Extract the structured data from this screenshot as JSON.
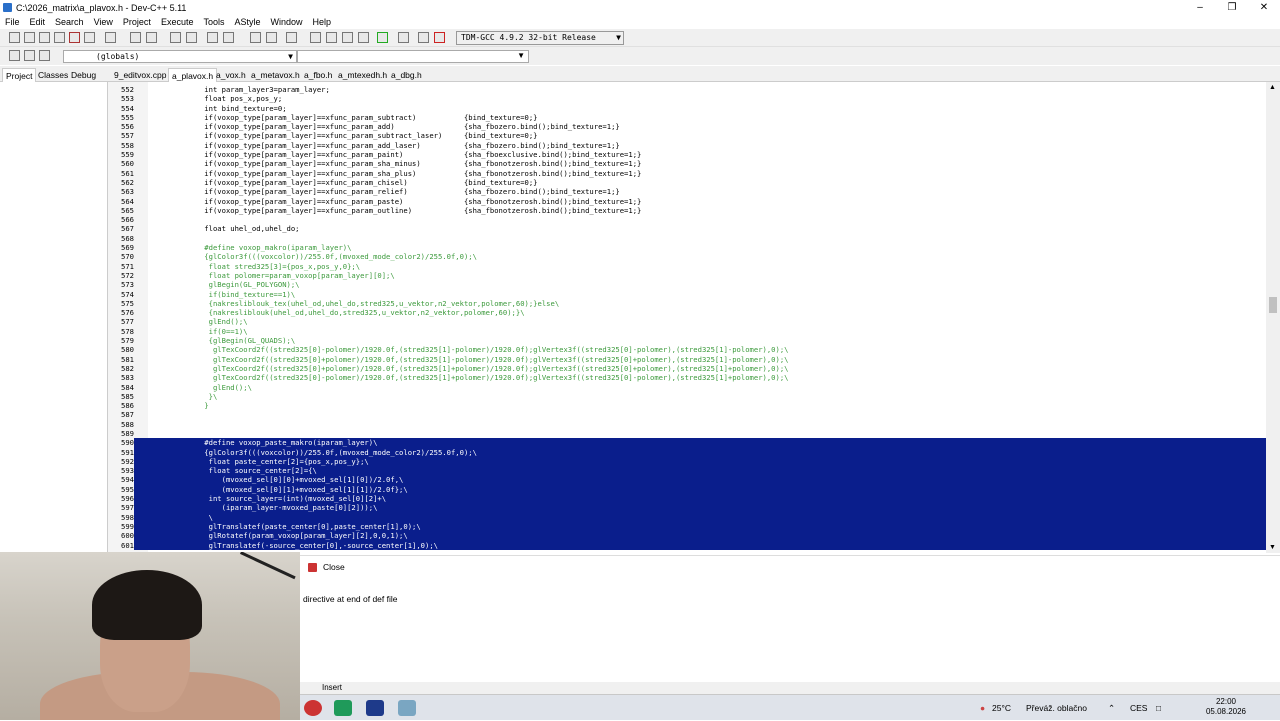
{
  "window": {
    "title": "C:\\2026_matrix\\a_plavox.h - Dev-C++ 5.11"
  },
  "menu": [
    "File",
    "Edit",
    "Search",
    "View",
    "Project",
    "Execute",
    "Tools",
    "AStyle",
    "Window",
    "Help"
  ],
  "compiler": "TDM-GCC 4.9.2 32-bit Release",
  "scope": "(globals)",
  "panel_tabs": [
    "Project",
    "Classes",
    "Debug"
  ],
  "file_tabs": [
    {
      "label": "9_editvox.cpp",
      "active": false
    },
    {
      "label": "a_plavox.h",
      "active": true
    },
    {
      "label": "a_vox.h",
      "active": false
    },
    {
      "label": "a_metavox.h",
      "active": false
    },
    {
      "label": "a_fbo.h",
      "active": false
    },
    {
      "label": "a_mtexedh.h",
      "active": false
    },
    {
      "label": "a_dbg.h",
      "active": false
    }
  ],
  "code_lines": [
    {
      "n": "552",
      "t": "    int param_layer3=param_layer;",
      "k": ""
    },
    {
      "n": "553",
      "t": "    float pos_x,pos_y;",
      "k": ""
    },
    {
      "n": "554",
      "t": "    int bind_texture=0;",
      "k": ""
    },
    {
      "n": "555",
      "t": "    if(voxop_type[param_layer]==xfunc_param_subtract)           {bind_texture=0;}",
      "k": ""
    },
    {
      "n": "556",
      "t": "    if(voxop_type[param_layer]==xfunc_param_add)                {sha_fbozero.bind();bind_texture=1;}",
      "k": ""
    },
    {
      "n": "557",
      "t": "    if(voxop_type[param_layer]==xfunc_param_subtract_laser)     {bind_texture=0;}",
      "k": ""
    },
    {
      "n": "558",
      "t": "    if(voxop_type[param_layer]==xfunc_param_add_laser)          {sha_fbozero.bind();bind_texture=1;}",
      "k": ""
    },
    {
      "n": "559",
      "t": "    if(voxop_type[param_layer]==xfunc_param_paint)              {sha_fboexclusive.bind();bind_texture=1;}",
      "k": ""
    },
    {
      "n": "560",
      "t": "    if(voxop_type[param_layer]==xfunc_param_sha_minus)          {sha_fbonotzerosh.bind();bind_texture=1;}",
      "k": ""
    },
    {
      "n": "561",
      "t": "    if(voxop_type[param_layer]==xfunc_param_sha_plus)           {sha_fbonotzerosh.bind();bind_texture=1;}",
      "k": ""
    },
    {
      "n": "562",
      "t": "    if(voxop_type[param_layer]==xfunc_param_chisel)             {bind_texture=0;}",
      "k": ""
    },
    {
      "n": "563",
      "t": "    if(voxop_type[param_layer]==xfunc_param_relief)             {sha_fbozero.bind();bind_texture=1;}",
      "k": ""
    },
    {
      "n": "564",
      "t": "    if(voxop_type[param_layer]==xfunc_param_paste)              {sha_fbonotzerosh.bind();bind_texture=1;}",
      "k": ""
    },
    {
      "n": "565",
      "t": "    if(voxop_type[param_layer]==xfunc_param_outline)            {sha_fbonotzerosh.bind();bind_texture=1;}",
      "k": ""
    },
    {
      "n": "566",
      "t": "",
      "k": ""
    },
    {
      "n": "567",
      "t": "    float uhel_od,uhel_do;",
      "k": ""
    },
    {
      "n": "568",
      "t": "",
      "k": ""
    },
    {
      "n": "569",
      "t": "    #define voxop_makro(iparam_layer)\\",
      "k": "macro"
    },
    {
      "n": "570",
      "t": "    {glColor3f(((voxcolor))/255.0f,(mvoxed_mode_color2)/255.0f,0);\\",
      "k": "macro"
    },
    {
      "n": "571",
      "t": "     float stred325[3]={pos_x,pos_y,0};\\",
      "k": "macro"
    },
    {
      "n": "572",
      "t": "     float polomer=param_voxop[param_layer][0];\\",
      "k": "macro"
    },
    {
      "n": "573",
      "t": "     glBegin(GL_POLYGON);\\",
      "k": "macro"
    },
    {
      "n": "574",
      "t": "     if(bind_texture==1)\\",
      "k": "macro"
    },
    {
      "n": "575",
      "t": "     {nakresliblouk_tex(uhel_od,uhel_do,stred325,u_vektor,n2_vektor,polomer,60);}else\\",
      "k": "macro"
    },
    {
      "n": "576",
      "t": "     {nakresliblouk(uhel_od,uhel_do,stred325,u_vektor,n2_vektor,polomer,60);}\\",
      "k": "macro"
    },
    {
      "n": "577",
      "t": "     glEnd();\\",
      "k": "macro"
    },
    {
      "n": "578",
      "t": "     if(0==1)\\",
      "k": "macro"
    },
    {
      "n": "579",
      "t": "     {glBegin(GL_QUADS);\\",
      "k": "macro"
    },
    {
      "n": "580",
      "t": "      glTexCoord2f((stred325[0]-polomer)/1920.0f,(stred325[1]-polomer)/1920.0f);glVertex3f((stred325[0]-polomer),(stred325[1]-polomer),0);\\",
      "k": "macro"
    },
    {
      "n": "581",
      "t": "      glTexCoord2f((stred325[0]+polomer)/1920.0f,(stred325[1]-polomer)/1920.0f);glVertex3f((stred325[0]+polomer),(stred325[1]-polomer),0);\\",
      "k": "macro"
    },
    {
      "n": "582",
      "t": "      glTexCoord2f((stred325[0]+polomer)/1920.0f,(stred325[1]+polomer)/1920.0f);glVertex3f((stred325[0]+polomer),(stred325[1]+polomer),0);\\",
      "k": "macro"
    },
    {
      "n": "583",
      "t": "      glTexCoord2f((stred325[0]-polomer)/1920.0f,(stred325[1]+polomer)/1920.0f);glVertex3f((stred325[0]-polomer),(stred325[1]+polomer),0);\\",
      "k": "macro"
    },
    {
      "n": "584",
      "t": "      glEnd();\\",
      "k": "macro"
    },
    {
      "n": "585",
      "t": "     }\\",
      "k": "macro"
    },
    {
      "n": "586",
      "t": "    }",
      "k": "macro"
    },
    {
      "n": "587",
      "t": "",
      "k": ""
    },
    {
      "n": "588",
      "t": "",
      "k": ""
    },
    {
      "n": "589",
      "t": "",
      "k": ""
    },
    {
      "n": "590",
      "t": "    #define voxop_paste_makro(iparam_layer)\\",
      "k": "sel"
    },
    {
      "n": "591",
      "t": "    {glColor3f(((voxcolor))/255.0f,(mvoxed_mode_color2)/255.0f,0);\\",
      "k": "sel"
    },
    {
      "n": "592",
      "t": "     float paste_center[2]={pos_x,pos_y};\\",
      "k": "sel"
    },
    {
      "n": "593",
      "t": "     float source_center[2]={\\",
      "k": "sel"
    },
    {
      "n": "594",
      "t": "        (mvoxed_sel[0][0]+mvoxed_sel[1][0])/2.0f,\\",
      "k": "sel"
    },
    {
      "n": "595",
      "t": "        (mvoxed_sel[0][1]+mvoxed_sel[1][1])/2.0f};\\",
      "k": "sel"
    },
    {
      "n": "596",
      "t": "     int source_layer=(int)(mvoxed_sel[0][2]+\\",
      "k": "sel"
    },
    {
      "n": "597",
      "t": "        (iparam_layer-mvoxed_paste[0][2]));\\",
      "k": "sel"
    },
    {
      "n": "598",
      "t": "     \\",
      "k": "sel"
    },
    {
      "n": "599",
      "t": "     glTranslatef(paste_center[0],paste_center[1],0);\\",
      "k": "sel"
    },
    {
      "n": "600",
      "t": "     glRotatef(param_voxop[param_layer][2],0,0,1);\\",
      "k": "sel"
    },
    {
      "n": "601",
      "t": "     glTranslatef(-source_center[0],-source_center[1],0);\\",
      "k": "sel"
    }
  ],
  "bottom": {
    "close_label": "Close",
    "message": "directive at end of def file"
  },
  "status": {
    "mode": "Insert"
  },
  "tray": {
    "temp": "25°C",
    "weather": "Převáž. oblačno",
    "lang": "CES",
    "time": "22:00",
    "date": "05.08.2026"
  }
}
